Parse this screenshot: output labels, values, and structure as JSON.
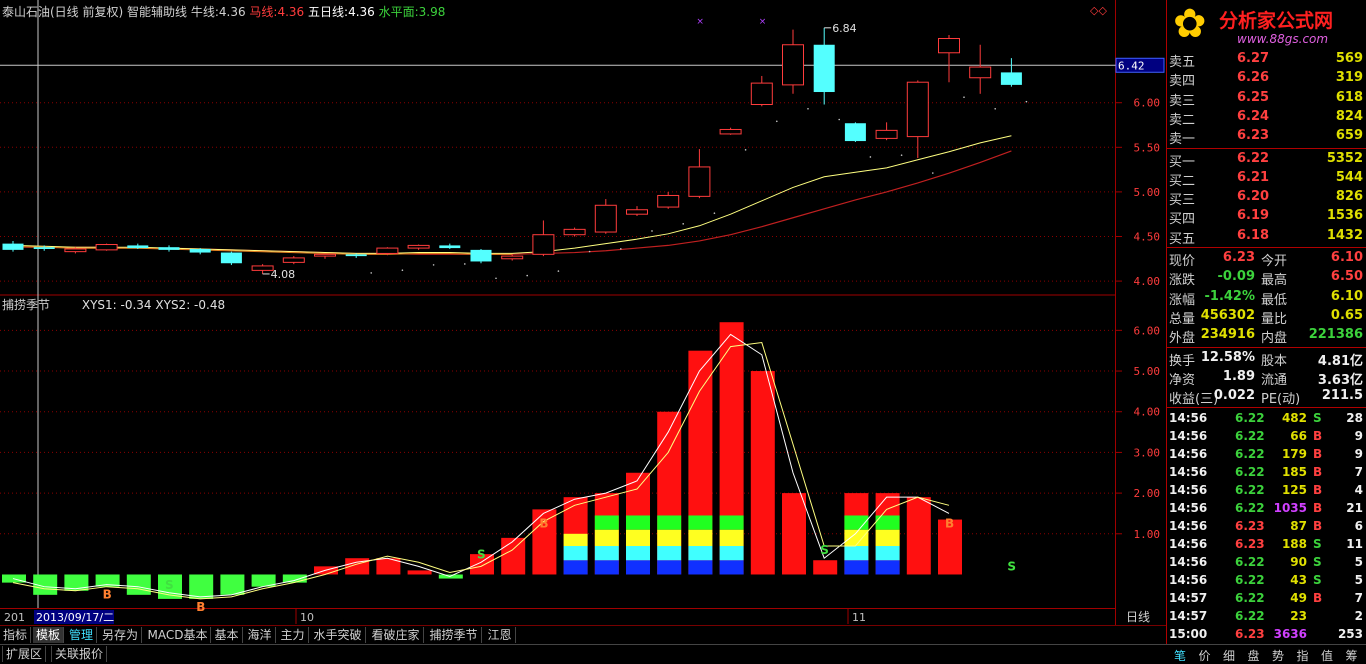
{
  "header": {
    "stock_label": "泰山石油(日线 前复权) 智能辅助线",
    "niu_label": "牛线:",
    "niu_value": "4.36",
    "ma_label": "马线:",
    "ma_value": "4.36",
    "wuri_label": "五日线:",
    "wuri_value": "4.36",
    "shui_label": "水平面:",
    "shui_value": "3.98"
  },
  "price_axis": [
    "6.00",
    "5.50",
    "5.00",
    "4.50",
    "4.00"
  ],
  "price_cursor": "6.42",
  "price_marks": {
    "high": "6.84",
    "low": "4.08"
  },
  "indicator": {
    "title": "捕捞季节",
    "xys1": "XYS1: -0.34",
    "xys2": "XYS2: -0.48",
    "axis": [
      "6.00",
      "5.00",
      "4.00",
      "3.00",
      "2.00",
      "1.00"
    ]
  },
  "date_axis": {
    "left_cut": "201",
    "cursor_date": "2013/09/17/二",
    "month_10": "10",
    "month_11": "11",
    "period": "日线"
  },
  "chart_data": {
    "type": "bar",
    "candles": [
      {
        "o": 4.42,
        "c": 4.35,
        "h": 4.45,
        "l": 4.33
      },
      {
        "o": 4.38,
        "c": 4.36,
        "h": 4.4,
        "l": 4.34
      },
      {
        "o": 4.33,
        "c": 4.36,
        "h": 4.38,
        "l": 4.31
      },
      {
        "o": 4.35,
        "c": 4.41,
        "h": 4.42,
        "l": 4.34
      },
      {
        "o": 4.4,
        "c": 4.37,
        "h": 4.42,
        "l": 4.36
      },
      {
        "o": 4.38,
        "c": 4.35,
        "h": 4.4,
        "l": 4.33
      },
      {
        "o": 4.36,
        "c": 4.32,
        "h": 4.37,
        "l": 4.3
      },
      {
        "o": 4.32,
        "c": 4.2,
        "h": 4.33,
        "l": 4.18
      },
      {
        "o": 4.12,
        "c": 4.17,
        "h": 4.19,
        "l": 4.08
      },
      {
        "o": 4.21,
        "c": 4.26,
        "h": 4.28,
        "l": 4.19
      },
      {
        "o": 4.28,
        "c": 4.3,
        "h": 4.31,
        "l": 4.25
      },
      {
        "o": 4.3,
        "c": 4.28,
        "h": 4.31,
        "l": 4.26
      },
      {
        "o": 4.31,
        "c": 4.37,
        "h": 4.38,
        "l": 4.29
      },
      {
        "o": 4.37,
        "c": 4.4,
        "h": 4.41,
        "l": 4.35
      },
      {
        "o": 4.4,
        "c": 4.37,
        "h": 4.42,
        "l": 4.36
      },
      {
        "o": 4.35,
        "c": 4.22,
        "h": 4.36,
        "l": 4.2
      },
      {
        "o": 4.25,
        "c": 4.28,
        "h": 4.3,
        "l": 4.23
      },
      {
        "o": 4.3,
        "c": 4.52,
        "h": 4.68,
        "l": 4.28
      },
      {
        "o": 4.52,
        "c": 4.58,
        "h": 4.6,
        "l": 4.5
      },
      {
        "o": 4.55,
        "c": 4.85,
        "h": 4.92,
        "l": 4.53
      },
      {
        "o": 4.75,
        "c": 4.8,
        "h": 4.84,
        "l": 4.73
      },
      {
        "o": 4.83,
        "c": 4.96,
        "h": 5.0,
        "l": 4.81
      },
      {
        "o": 4.95,
        "c": 5.28,
        "h": 5.48,
        "l": 4.93
      },
      {
        "o": 5.65,
        "c": 5.7,
        "h": 5.72,
        "l": 5.64
      },
      {
        "o": 5.98,
        "c": 6.22,
        "h": 6.3,
        "l": 5.96
      },
      {
        "o": 6.2,
        "c": 6.65,
        "h": 6.82,
        "l": 6.1
      },
      {
        "o": 6.65,
        "c": 6.12,
        "h": 6.84,
        "l": 5.98
      },
      {
        "o": 5.77,
        "c": 5.57,
        "h": 5.78,
        "l": 5.56
      },
      {
        "o": 5.6,
        "c": 5.69,
        "h": 5.78,
        "l": 5.58
      },
      {
        "o": 5.62,
        "c": 6.23,
        "h": 6.25,
        "l": 5.38
      },
      {
        "o": 6.56,
        "c": 6.72,
        "h": 6.76,
        "l": 6.23
      },
      {
        "o": 6.28,
        "c": 6.4,
        "h": 6.65,
        "l": 6.1
      },
      {
        "o": 6.34,
        "c": 6.2,
        "h": 6.5,
        "l": 6.18
      }
    ],
    "ma_yellow": [
      4.4,
      4.39,
      4.38,
      4.38,
      4.38,
      4.37,
      4.36,
      4.35,
      4.34,
      4.33,
      4.32,
      4.31,
      4.31,
      4.32,
      4.32,
      4.31,
      4.31,
      4.33,
      4.37,
      4.42,
      4.47,
      4.53,
      4.62,
      4.75,
      4.9,
      5.05,
      5.17,
      5.22,
      5.27,
      5.36,
      5.45,
      5.55,
      5.63
    ],
    "ma_red": [
      4.38,
      4.38,
      4.38,
      4.38,
      4.37,
      4.37,
      4.36,
      4.35,
      4.34,
      4.33,
      4.32,
      4.31,
      4.31,
      4.3,
      4.3,
      4.3,
      4.3,
      4.31,
      4.32,
      4.34,
      4.37,
      4.4,
      4.45,
      4.52,
      4.61,
      4.71,
      4.81,
      4.91,
      5.0,
      5.1,
      5.21,
      5.33,
      5.46
    ],
    "ind_bars": [
      -0.2,
      -0.5,
      -0.4,
      -0.3,
      -0.5,
      -0.6,
      -0.6,
      -0.5,
      -0.3,
      -0.2,
      0.2,
      0.4,
      0.4,
      0.1,
      -0.1,
      0.5,
      0.9,
      1.6,
      1.9,
      2.0,
      2.5,
      4.0,
      5.5,
      6.2,
      5.0,
      2.0,
      0.35,
      2.0,
      2.0,
      1.9,
      1.35
    ],
    "ind_layers": [
      0,
      0,
      0,
      0,
      0,
      0,
      0,
      0,
      0,
      0,
      0,
      0,
      0,
      0,
      0,
      0,
      0,
      0,
      1.0,
      1.45,
      1.45,
      1.45,
      1.45,
      1.45,
      0,
      0,
      0,
      1.45,
      1.45,
      0,
      0
    ],
    "ind_line1": [
      -0.1,
      -0.3,
      -0.35,
      -0.25,
      -0.3,
      -0.45,
      -0.55,
      -0.5,
      -0.3,
      -0.15,
      0.1,
      0.3,
      0.4,
      0.2,
      -0.05,
      0.3,
      0.8,
      1.5,
      1.85,
      2.0,
      2.3,
      3.5,
      5.0,
      5.9,
      5.4,
      2.5,
      0.4,
      1.0,
      1.9,
      1.9,
      1.5
    ],
    "ind_line2": [
      -0.2,
      -0.35,
      -0.4,
      -0.3,
      -0.35,
      -0.5,
      -0.6,
      -0.55,
      -0.35,
      -0.2,
      0.0,
      0.25,
      0.45,
      0.3,
      0.05,
      0.2,
      0.6,
      1.3,
      1.7,
      1.9,
      2.1,
      3.0,
      4.5,
      5.6,
      5.7,
      3.2,
      0.7,
      0.7,
      1.6,
      1.9,
      1.7
    ],
    "signals": [
      {
        "i": 3,
        "t": "B"
      },
      {
        "i": 6,
        "t": "B"
      },
      {
        "i": 5,
        "t": "S"
      },
      {
        "i": 15,
        "t": "S"
      },
      {
        "i": 17,
        "t": "B"
      },
      {
        "i": 26,
        "t": "S"
      },
      {
        "i": 30,
        "t": "B"
      },
      {
        "i": 32,
        "t": "S"
      }
    ],
    "ylim_price": [
      3.9,
      6.95
    ],
    "ylim_ind": [
      -0.75,
      6.5
    ]
  },
  "quote": {
    "sell": [
      {
        "label": "卖五",
        "price": "6.27",
        "vol": "569"
      },
      {
        "label": "卖四",
        "price": "6.26",
        "vol": "319"
      },
      {
        "label": "卖三",
        "price": "6.25",
        "vol": "618"
      },
      {
        "label": "卖二",
        "price": "6.24",
        "vol": "824"
      },
      {
        "label": "卖一",
        "price": "6.23",
        "vol": "659"
      }
    ],
    "buy": [
      {
        "label": "买一",
        "price": "6.22",
        "vol": "5352"
      },
      {
        "label": "买二",
        "price": "6.21",
        "vol": "544"
      },
      {
        "label": "买三",
        "price": "6.20",
        "vol": "826"
      },
      {
        "label": "买四",
        "price": "6.19",
        "vol": "1536"
      },
      {
        "label": "买五",
        "price": "6.18",
        "vol": "1432"
      }
    ],
    "stats": [
      {
        "l1": "现价",
        "v1": "6.23",
        "l2": "今开",
        "v2": "6.10"
      },
      {
        "l1": "涨跌",
        "v1": "-0.09",
        "l2": "最高",
        "v2": "6.50"
      },
      {
        "l1": "涨幅",
        "v1": "-1.42%",
        "l2": "最低",
        "v2": "6.10"
      },
      {
        "l1": "总量",
        "v1": "456302",
        "l2": "量比",
        "v2": "0.65"
      },
      {
        "l1": "外盘",
        "v1": "234916",
        "l2": "内盘",
        "v2": "221386"
      }
    ],
    "stats2": [
      {
        "l1": "换手",
        "v1": "12.58%",
        "l2": "股本",
        "v2": "4.81亿"
      },
      {
        "l1": "净资",
        "v1": "1.89",
        "l2": "流通",
        "v2": "3.63亿"
      },
      {
        "l1": "收益(三)",
        "v1": "0.022",
        "l2": "PE(动)",
        "v2": "211.5"
      }
    ]
  },
  "ticks": [
    {
      "t": "14:56",
      "p": "6.22",
      "v": "482",
      "s": "S",
      "n": "28"
    },
    {
      "t": "14:56",
      "p": "6.22",
      "v": "66",
      "s": "B",
      "n": "9"
    },
    {
      "t": "14:56",
      "p": "6.22",
      "v": "179",
      "s": "B",
      "n": "9"
    },
    {
      "t": "14:56",
      "p": "6.22",
      "v": "185",
      "s": "B",
      "n": "7"
    },
    {
      "t": "14:56",
      "p": "6.22",
      "v": "125",
      "s": "B",
      "n": "4"
    },
    {
      "t": "14:56",
      "p": "6.22",
      "v": "1035",
      "s": "B",
      "n": "21"
    },
    {
      "t": "14:56",
      "p": "6.23",
      "v": "87",
      "s": "B",
      "n": "6"
    },
    {
      "t": "14:56",
      "p": "6.23",
      "v": "188",
      "s": "S",
      "n": "11"
    },
    {
      "t": "14:56",
      "p": "6.22",
      "v": "90",
      "s": "S",
      "n": "5"
    },
    {
      "t": "14:56",
      "p": "6.22",
      "v": "43",
      "s": "S",
      "n": "5"
    },
    {
      "t": "14:57",
      "p": "6.22",
      "v": "49",
      "s": "B",
      "n": "7"
    },
    {
      "t": "14:57",
      "p": "6.22",
      "v": "23",
      "s": "",
      "n": "2"
    },
    {
      "t": "15:00",
      "p": "6.23",
      "v": "3636",
      "s": "",
      "n": "253"
    }
  ],
  "tabs": [
    "指标",
    "模板",
    "管理",
    "另存为",
    "MACD基本",
    "基本",
    "海洋",
    "主力",
    "水手突破",
    "看破庄家",
    "捕捞季节",
    "江恩"
  ],
  "bottom_tabs": [
    "扩展区",
    "关联报价"
  ],
  "right_bottom_tabs": [
    "笔",
    "价",
    "细",
    "盘",
    "势",
    "指",
    "值",
    "筹"
  ],
  "logo": {
    "title": "分析家公式网",
    "url": "www.88gs.com"
  },
  "colors": {
    "up": "#ff3c3c",
    "down": "#54ffff",
    "ma_yellow": "#ffff80",
    "ma_red": "#c02020",
    "grid": "#8b0000"
  }
}
